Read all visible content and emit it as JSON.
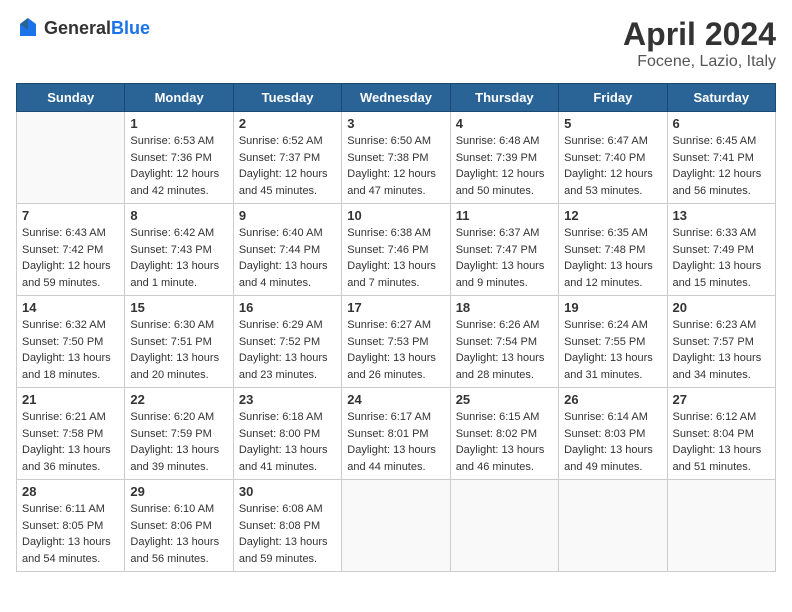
{
  "header": {
    "logo_general": "General",
    "logo_blue": "Blue",
    "month_title": "April 2024",
    "location": "Focene, Lazio, Italy"
  },
  "days_of_week": [
    "Sunday",
    "Monday",
    "Tuesday",
    "Wednesday",
    "Thursday",
    "Friday",
    "Saturday"
  ],
  "weeks": [
    [
      {
        "day": "",
        "sunrise": "",
        "sunset": "",
        "daylight": ""
      },
      {
        "day": "1",
        "sunrise": "Sunrise: 6:53 AM",
        "sunset": "Sunset: 7:36 PM",
        "daylight": "Daylight: 12 hours and 42 minutes."
      },
      {
        "day": "2",
        "sunrise": "Sunrise: 6:52 AM",
        "sunset": "Sunset: 7:37 PM",
        "daylight": "Daylight: 12 hours and 45 minutes."
      },
      {
        "day": "3",
        "sunrise": "Sunrise: 6:50 AM",
        "sunset": "Sunset: 7:38 PM",
        "daylight": "Daylight: 12 hours and 47 minutes."
      },
      {
        "day": "4",
        "sunrise": "Sunrise: 6:48 AM",
        "sunset": "Sunset: 7:39 PM",
        "daylight": "Daylight: 12 hours and 50 minutes."
      },
      {
        "day": "5",
        "sunrise": "Sunrise: 6:47 AM",
        "sunset": "Sunset: 7:40 PM",
        "daylight": "Daylight: 12 hours and 53 minutes."
      },
      {
        "day": "6",
        "sunrise": "Sunrise: 6:45 AM",
        "sunset": "Sunset: 7:41 PM",
        "daylight": "Daylight: 12 hours and 56 minutes."
      }
    ],
    [
      {
        "day": "7",
        "sunrise": "Sunrise: 6:43 AM",
        "sunset": "Sunset: 7:42 PM",
        "daylight": "Daylight: 12 hours and 59 minutes."
      },
      {
        "day": "8",
        "sunrise": "Sunrise: 6:42 AM",
        "sunset": "Sunset: 7:43 PM",
        "daylight": "Daylight: 13 hours and 1 minute."
      },
      {
        "day": "9",
        "sunrise": "Sunrise: 6:40 AM",
        "sunset": "Sunset: 7:44 PM",
        "daylight": "Daylight: 13 hours and 4 minutes."
      },
      {
        "day": "10",
        "sunrise": "Sunrise: 6:38 AM",
        "sunset": "Sunset: 7:46 PM",
        "daylight": "Daylight: 13 hours and 7 minutes."
      },
      {
        "day": "11",
        "sunrise": "Sunrise: 6:37 AM",
        "sunset": "Sunset: 7:47 PM",
        "daylight": "Daylight: 13 hours and 9 minutes."
      },
      {
        "day": "12",
        "sunrise": "Sunrise: 6:35 AM",
        "sunset": "Sunset: 7:48 PM",
        "daylight": "Daylight: 13 hours and 12 minutes."
      },
      {
        "day": "13",
        "sunrise": "Sunrise: 6:33 AM",
        "sunset": "Sunset: 7:49 PM",
        "daylight": "Daylight: 13 hours and 15 minutes."
      }
    ],
    [
      {
        "day": "14",
        "sunrise": "Sunrise: 6:32 AM",
        "sunset": "Sunset: 7:50 PM",
        "daylight": "Daylight: 13 hours and 18 minutes."
      },
      {
        "day": "15",
        "sunrise": "Sunrise: 6:30 AM",
        "sunset": "Sunset: 7:51 PM",
        "daylight": "Daylight: 13 hours and 20 minutes."
      },
      {
        "day": "16",
        "sunrise": "Sunrise: 6:29 AM",
        "sunset": "Sunset: 7:52 PM",
        "daylight": "Daylight: 13 hours and 23 minutes."
      },
      {
        "day": "17",
        "sunrise": "Sunrise: 6:27 AM",
        "sunset": "Sunset: 7:53 PM",
        "daylight": "Daylight: 13 hours and 26 minutes."
      },
      {
        "day": "18",
        "sunrise": "Sunrise: 6:26 AM",
        "sunset": "Sunset: 7:54 PM",
        "daylight": "Daylight: 13 hours and 28 minutes."
      },
      {
        "day": "19",
        "sunrise": "Sunrise: 6:24 AM",
        "sunset": "Sunset: 7:55 PM",
        "daylight": "Daylight: 13 hours and 31 minutes."
      },
      {
        "day": "20",
        "sunrise": "Sunrise: 6:23 AM",
        "sunset": "Sunset: 7:57 PM",
        "daylight": "Daylight: 13 hours and 34 minutes."
      }
    ],
    [
      {
        "day": "21",
        "sunrise": "Sunrise: 6:21 AM",
        "sunset": "Sunset: 7:58 PM",
        "daylight": "Daylight: 13 hours and 36 minutes."
      },
      {
        "day": "22",
        "sunrise": "Sunrise: 6:20 AM",
        "sunset": "Sunset: 7:59 PM",
        "daylight": "Daylight: 13 hours and 39 minutes."
      },
      {
        "day": "23",
        "sunrise": "Sunrise: 6:18 AM",
        "sunset": "Sunset: 8:00 PM",
        "daylight": "Daylight: 13 hours and 41 minutes."
      },
      {
        "day": "24",
        "sunrise": "Sunrise: 6:17 AM",
        "sunset": "Sunset: 8:01 PM",
        "daylight": "Daylight: 13 hours and 44 minutes."
      },
      {
        "day": "25",
        "sunrise": "Sunrise: 6:15 AM",
        "sunset": "Sunset: 8:02 PM",
        "daylight": "Daylight: 13 hours and 46 minutes."
      },
      {
        "day": "26",
        "sunrise": "Sunrise: 6:14 AM",
        "sunset": "Sunset: 8:03 PM",
        "daylight": "Daylight: 13 hours and 49 minutes."
      },
      {
        "day": "27",
        "sunrise": "Sunrise: 6:12 AM",
        "sunset": "Sunset: 8:04 PM",
        "daylight": "Daylight: 13 hours and 51 minutes."
      }
    ],
    [
      {
        "day": "28",
        "sunrise": "Sunrise: 6:11 AM",
        "sunset": "Sunset: 8:05 PM",
        "daylight": "Daylight: 13 hours and 54 minutes."
      },
      {
        "day": "29",
        "sunrise": "Sunrise: 6:10 AM",
        "sunset": "Sunset: 8:06 PM",
        "daylight": "Daylight: 13 hours and 56 minutes."
      },
      {
        "day": "30",
        "sunrise": "Sunrise: 6:08 AM",
        "sunset": "Sunset: 8:08 PM",
        "daylight": "Daylight: 13 hours and 59 minutes."
      },
      {
        "day": "",
        "sunrise": "",
        "sunset": "",
        "daylight": ""
      },
      {
        "day": "",
        "sunrise": "",
        "sunset": "",
        "daylight": ""
      },
      {
        "day": "",
        "sunrise": "",
        "sunset": "",
        "daylight": ""
      },
      {
        "day": "",
        "sunrise": "",
        "sunset": "",
        "daylight": ""
      }
    ]
  ]
}
